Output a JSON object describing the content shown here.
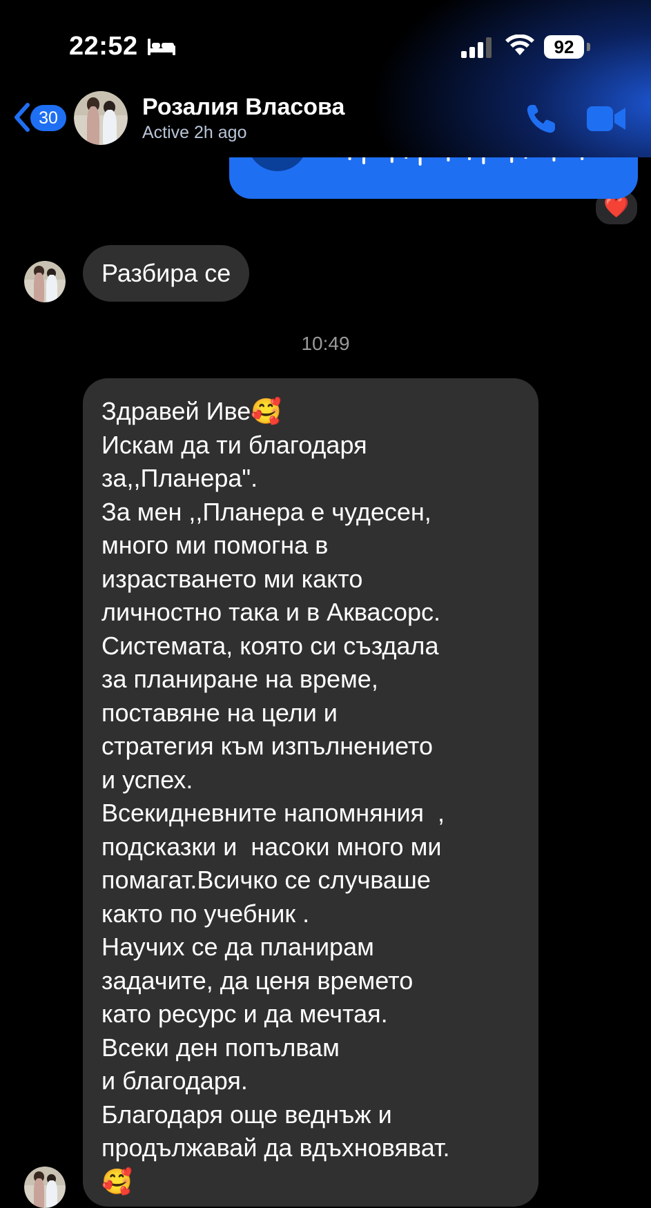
{
  "status_bar": {
    "time": "22:52",
    "battery": "92",
    "icons": [
      "bed-icon",
      "signal-icon",
      "wifi-icon",
      "battery-icon"
    ]
  },
  "header": {
    "back_count": "30",
    "contact_name": "Розалия Власова",
    "contact_status": "Active 2h ago",
    "icons": [
      "back-chevron-icon",
      "phone-icon",
      "video-camera-icon"
    ],
    "accent_color": "#1f6ff2"
  },
  "conversation": {
    "voice_message": {
      "direction": "outgoing",
      "reaction": "❤️"
    },
    "messages": [
      {
        "direction": "incoming",
        "text": "Разбира се"
      }
    ],
    "timestamp": "10:49",
    "long_message": {
      "direction": "incoming",
      "lines": [
        "Здравей Иве🥰",
        "Искам да ти благодаря",
        "за,,Планера\".",
        "За мен ,,Планера е чудесен,",
        "много ми помогна в",
        "израстването ми както",
        "личностно така и в Аквасорс.",
        "Системата, която си създала",
        "за планиране на време,",
        "поставяне на цели и",
        "стратегия към изпълнението",
        "и успех.",
        "Всекидневните напомняния  ,",
        "подсказки и  насоки много ми",
        "помагат.Всичко се случваше",
        "както по учебник .",
        "Научих се да планирам",
        "задачите, да ценя времето",
        "като ресурс и да мечтая.",
        "Всеки ден попълвам",
        "и благодаря.",
        "Благодаря още веднъж и",
        "продължавай да вдъхновяват.",
        "🥰"
      ]
    }
  },
  "colors": {
    "background": "#000000",
    "incoming_bubble": "#303030",
    "outgoing_bubble": "#1f6ff2"
  }
}
